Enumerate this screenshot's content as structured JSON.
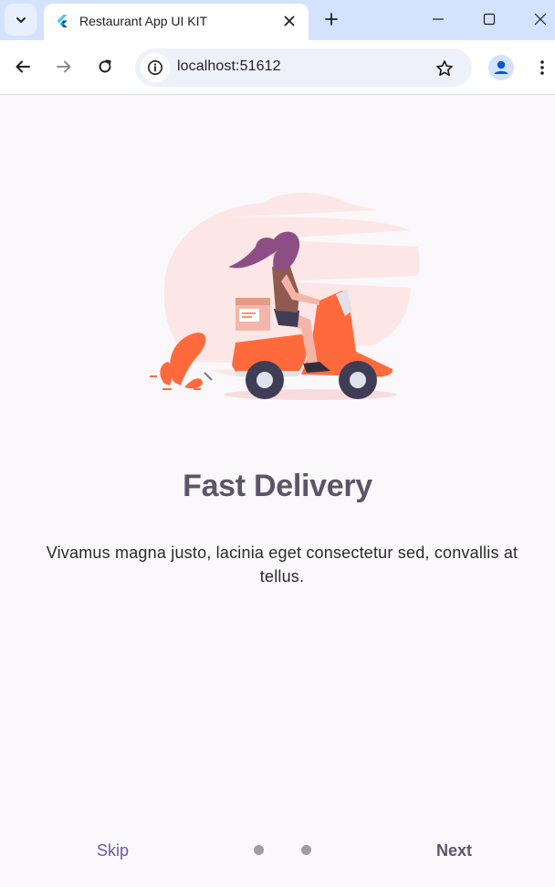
{
  "browser": {
    "tab_title": "Restaurant App UI KIT",
    "url": "localhost:51612",
    "icons": {
      "tab_search": "chevron-down-icon",
      "favicon": "flutter-logo-icon",
      "tab_close": "close-icon",
      "new_tab": "plus-icon",
      "minimize": "minimize-icon",
      "maximize": "maximize-icon",
      "close_window": "close-icon",
      "back": "arrow-left-icon",
      "forward": "arrow-right-icon",
      "reload": "reload-icon",
      "site_info": "info-icon",
      "bookmark": "star-icon",
      "profile": "person-icon",
      "menu": "more-vert-icon"
    }
  },
  "onboarding": {
    "illustration": "delivery-scooter-icon",
    "title": "Fast Delivery",
    "description": "Vivamus magna justo, lacinia eget consectetur sed, convallis at tellus.",
    "skip_label": "Skip",
    "next_label": "Next",
    "page_indicator": {
      "count": 2,
      "active_index": 0
    }
  },
  "colors": {
    "page_background": "#fbf8fc",
    "title": "#5b5569",
    "skip": "#6a5a9e",
    "accent": "#ff6a3d",
    "dot": "#9e9e9e"
  }
}
